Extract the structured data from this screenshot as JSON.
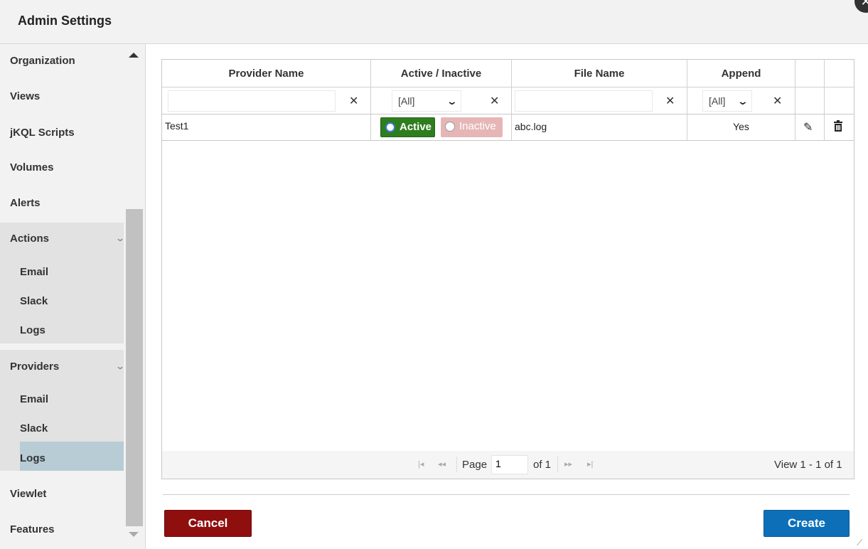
{
  "dialog": {
    "title": "Admin Settings"
  },
  "sidebar": {
    "items": [
      {
        "label": "Organization"
      },
      {
        "label": "Views"
      },
      {
        "label": "jKQL Scripts"
      },
      {
        "label": "Volumes"
      },
      {
        "label": "Alerts"
      },
      {
        "label": "Actions",
        "expanded": true,
        "children": [
          "Email",
          "Slack",
          "Logs"
        ]
      },
      {
        "label": "Providers",
        "expanded": true,
        "children": [
          "Email",
          "Slack",
          "Logs"
        ],
        "selected_child": "Logs"
      },
      {
        "label": "Viewlet"
      },
      {
        "label": "Features"
      }
    ]
  },
  "grid": {
    "columns": [
      "Provider Name",
      "Active / Inactive",
      "File Name",
      "Append"
    ],
    "filters": {
      "status": "[All]",
      "append": "[All]"
    },
    "rows": [
      {
        "provider_name": "Test1",
        "active_label": "Active",
        "inactive_label": "Inactive",
        "status": "Active",
        "file_name": "abc.log",
        "append": "Yes"
      }
    ],
    "pager": {
      "page_label": "Page",
      "page": "1",
      "of_label": "of 1",
      "view": "View 1 - 1 of 1"
    }
  },
  "buttons": {
    "cancel": "Cancel",
    "create": "Create"
  },
  "colors": {
    "active": "#2e7d1e",
    "inactive": "#e6b6b6",
    "cancel": "#8f0f0f",
    "create": "#0d6fb8",
    "selected_nav": "#b7ccd5"
  }
}
